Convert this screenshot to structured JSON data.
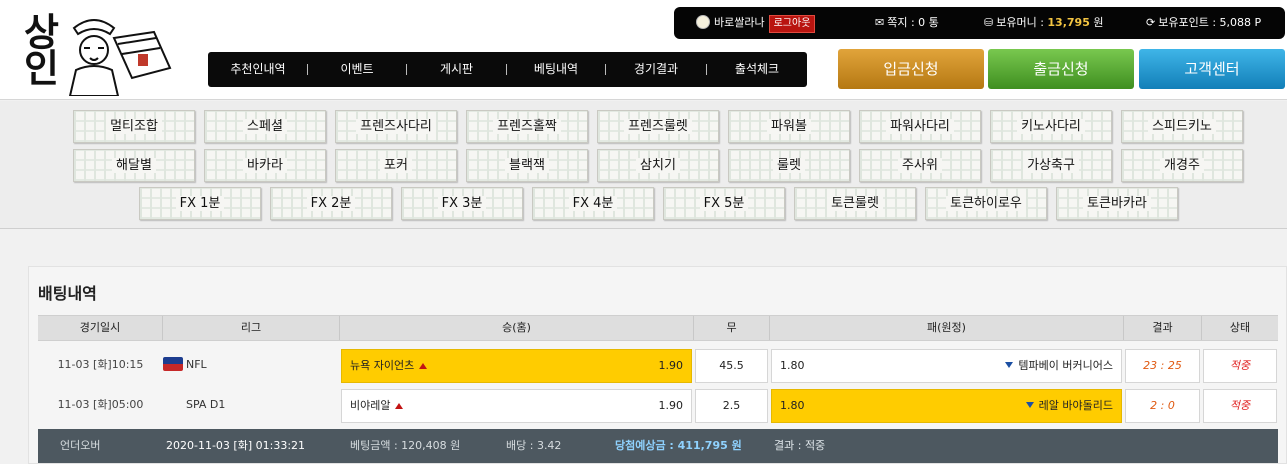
{
  "logo": {
    "text": "상인"
  },
  "userbar": {
    "username": "바로쌀라나",
    "logout": "로그아웃",
    "message_label": "쪽지 : 0 통",
    "money_label": "보유머니 :",
    "money_value": "13,795",
    "money_unit": "원",
    "points_label": "보유포인트 : 5,088 P"
  },
  "nav": [
    "추천인내역",
    "이벤트",
    "게시판",
    "베팅내역",
    "경기결과",
    "출석체크"
  ],
  "buttons": {
    "deposit": "입금신청",
    "withdraw": "출금신청",
    "cs": "고객센터"
  },
  "games": {
    "row1": [
      "멀티조합",
      "스페셜",
      "프렌즈사다리",
      "프렌즈홀짝",
      "프렌즈룰렛",
      "파워볼",
      "파워사다리",
      "키노사다리",
      "스피드키노"
    ],
    "row2": [
      "해달별",
      "바카라",
      "포커",
      "블랙잭",
      "삼치기",
      "룰렛",
      "주사위",
      "가상축구",
      "개경주"
    ],
    "row3": [
      "FX 1분",
      "FX 2분",
      "FX 3분",
      "FX 4분",
      "FX 5분",
      "토큰룰렛",
      "토큰하이로우",
      "토큰바카라"
    ]
  },
  "betting": {
    "title": "배팅내역",
    "headers": [
      "경기일시",
      "리그",
      "승(홈)",
      "무",
      "패(원정)",
      "결과",
      "상태"
    ],
    "rows": [
      {
        "date": "11-03 [화]10:15",
        "league": "NFL",
        "home": "뉴욕 자이언츠",
        "home_odds": "1.90",
        "draw": "45.5",
        "away_odds": "1.80",
        "away": "템파베이 버커니어스",
        "result": "23 : 25",
        "status": "적중",
        "selected": "home"
      },
      {
        "date": "11-03 [화]05:00",
        "league": "SPA D1",
        "home": "비야레알",
        "home_odds": "1.90",
        "draw": "2.5",
        "away_odds": "1.80",
        "away": "레알 바야돌리드",
        "result": "2 : 0",
        "status": "적중",
        "selected": "away"
      }
    ],
    "summary": {
      "type": "언더오버",
      "datetime": "2020-11-03 [화] 01:33:21",
      "amount": "베팅금액 : 120,408 원",
      "odds": "배당 : 3.42",
      "expected": "당첨예상금 : 411,795 원",
      "result": "결과 : 적중"
    }
  },
  "colors": {
    "selected": "#ffcc00",
    "deposit": "#c98a22",
    "withdraw": "#56a832",
    "cs": "#1f93cf",
    "summary_bg": "#4d5860"
  }
}
